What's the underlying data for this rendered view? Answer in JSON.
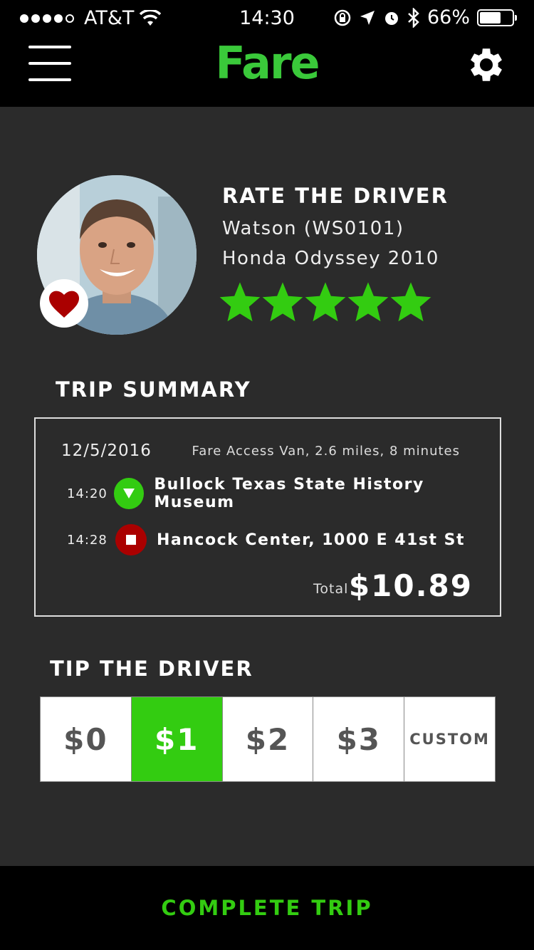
{
  "status_bar": {
    "carrier": "AT&T",
    "time": "14:30",
    "battery": "66%",
    "battery_level": 0.66
  },
  "header": {
    "brand": "Fare",
    "menu_icon": "hamburger-menu-icon",
    "settings_icon": "gear-icon"
  },
  "driver": {
    "section_title": "RATE THE DRIVER",
    "name": "Watson (WS0101)",
    "vehicle": "Honda Odyssey 2010",
    "rating": 5,
    "rating_max": 5,
    "favorite": true,
    "star_color": "#33cc11"
  },
  "trip": {
    "section_title": "TRIP SUMMARY",
    "date": "12/5/2016",
    "details": "Fare Access Van, 2.6 miles, 8 minutes",
    "pickup": {
      "time": "14:20",
      "place": "Bullock Texas State History Museum",
      "color": "#33cc11"
    },
    "dropoff": {
      "time": "14:28",
      "place": "Hancock Center, 1000 E 41st St",
      "color": "#aa0000"
    },
    "total_label": "Total",
    "total": "$10.89"
  },
  "tip": {
    "section_title": "TIP THE DRIVER",
    "options": [
      "$0",
      "$1",
      "$2",
      "$3",
      "CUSTOM"
    ],
    "selected": "$1",
    "accent": "#33cc11"
  },
  "action": {
    "complete_label": "COMPLETE TRIP"
  }
}
